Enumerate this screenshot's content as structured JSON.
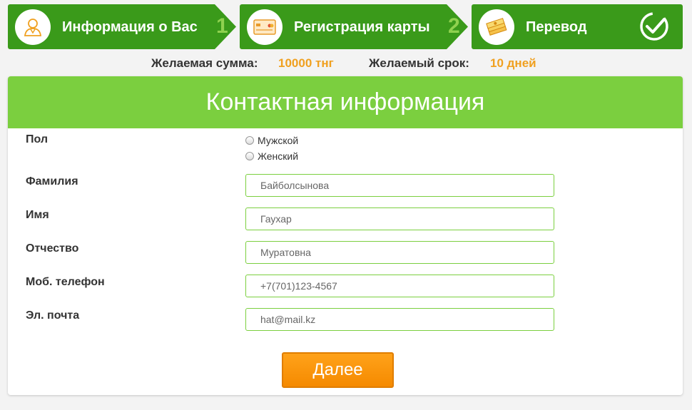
{
  "steps": [
    {
      "label": "Информация о Вас",
      "number": "1",
      "icon": "user-icon"
    },
    {
      "label": "Регистрация карты",
      "number": "2",
      "icon": "credit-card-icon"
    },
    {
      "label": "Перевод",
      "icon": "money-stack-icon",
      "status_icon": "checkmark-icon"
    }
  ],
  "summary": {
    "amount_label": "Желаемая сумма:",
    "amount_value": "10000 тнг",
    "term_label": "Желаемый срок:",
    "term_value": "10 дней"
  },
  "form": {
    "title": "Контактная информация",
    "gender_label": "Пол",
    "gender_options": [
      "Мужской",
      "Женский"
    ],
    "surname_label": "Фамилия",
    "surname_placeholder": "Байболсынова",
    "name_label": "Имя",
    "name_placeholder": "Гаухар",
    "patronymic_label": "Отчество",
    "patronymic_placeholder": "Муратовна",
    "phone_label": "Моб. телефон",
    "phone_placeholder": "+7(701)123-4567",
    "email_label": "Эл. почта",
    "email_placeholder": "hat@mail.kz",
    "next_button": "Далее"
  },
  "colors": {
    "step_green": "#3a9a1a",
    "header_green": "#7bcf3f",
    "accent_orange": "#f0a020",
    "button_orange": "#f58a00"
  }
}
